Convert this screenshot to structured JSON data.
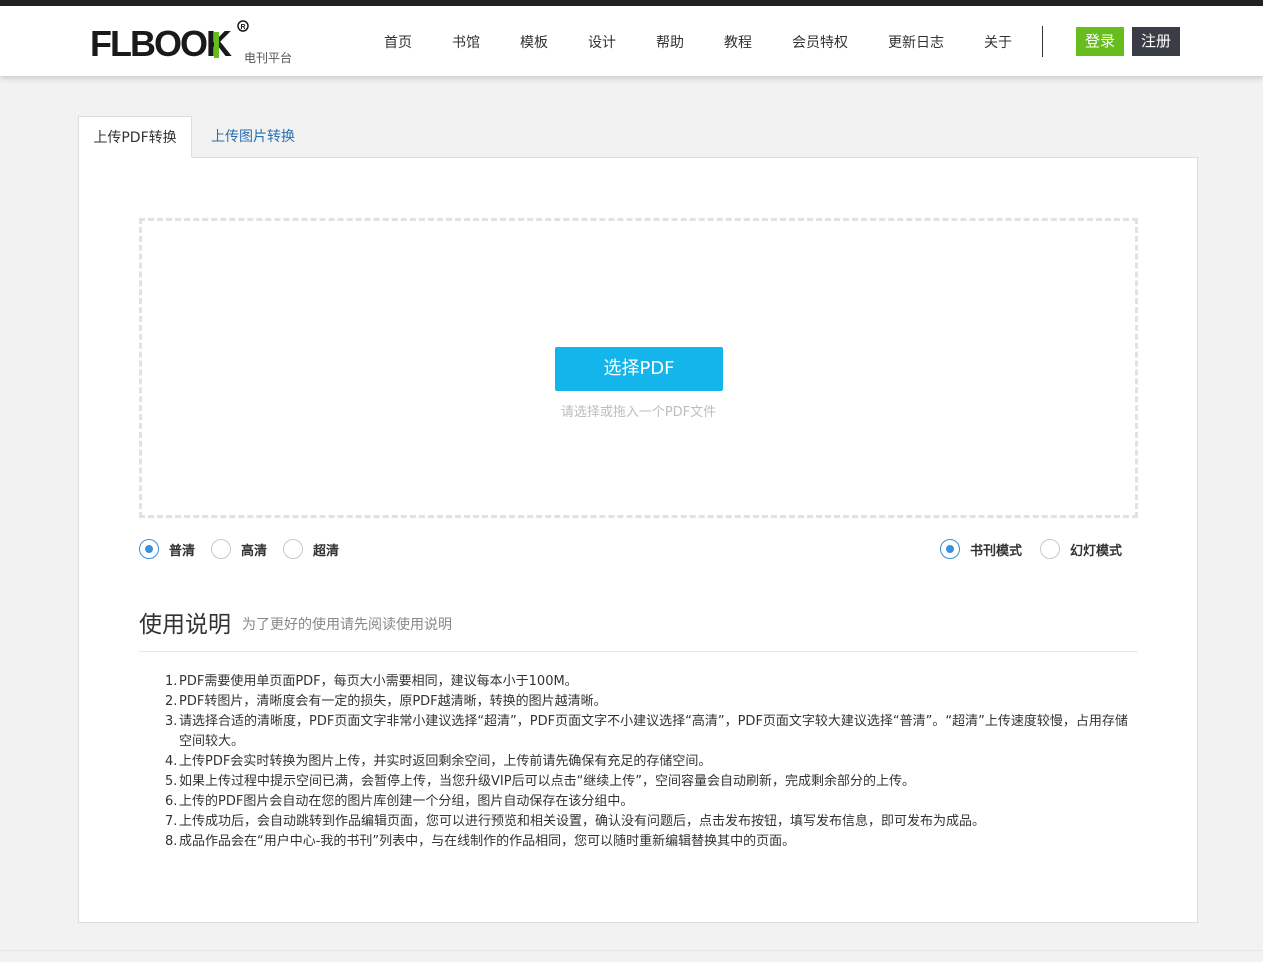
{
  "header": {
    "logo_text": "FLBOOK",
    "logo_subtitle": "电刊平台",
    "nav": [
      {
        "label": "首页"
      },
      {
        "label": "书馆"
      },
      {
        "label": "模板"
      },
      {
        "label": "设计"
      },
      {
        "label": "帮助"
      },
      {
        "label": "教程"
      },
      {
        "label": "会员特权"
      },
      {
        "label": "更新日志"
      },
      {
        "label": "关于"
      }
    ],
    "login_label": "登录",
    "register_label": "注册",
    "colors": {
      "login": "#67bd1d",
      "register": "#3a3d45"
    }
  },
  "tabs": [
    {
      "label": "上传PDF转换",
      "active": true
    },
    {
      "label": "上传图片转换",
      "active": false
    }
  ],
  "upload": {
    "button_label": "选择PDF",
    "hint": "请选择或拖入一个PDF文件",
    "button_color": "#13b5ea"
  },
  "quality_options": [
    {
      "label": "普清",
      "checked": true
    },
    {
      "label": "高清",
      "checked": false
    },
    {
      "label": "超清",
      "checked": false
    }
  ],
  "mode_options": [
    {
      "label": "书刊模式",
      "checked": true
    },
    {
      "label": "幻灯模式",
      "checked": false
    }
  ],
  "instructions": {
    "title": "使用说明",
    "subtitle": "为了更好的使用请先阅读使用说明",
    "items": [
      "PDF需要使用单页面PDF，每页大小需要相同，建议每本小于100M。",
      "PDF转图片，清晰度会有一定的损失，原PDF越清晰，转换的图片越清晰。",
      "请选择合适的清晰度，PDF页面文字非常小建议选择“超清”，PDF页面文字不小建议选择“高清”，PDF页面文字较大建议选择“普清”。“超清”上传速度较慢，占用存储空间较大。",
      "上传PDF会实时转换为图片上传，并实时返回剩余空间，上传前请先确保有充足的存储空间。",
      "如果上传过程中提示空间已满，会暂停上传，当您升级VIP后可以点击“继续上传”，空间容量会自动刷新，完成剩余部分的上传。",
      "上传的PDF图片会自动在您的图片库创建一个分组，图片自动保存在该分组中。",
      "上传成功后，会自动跳转到作品编辑页面，您可以进行预览和相关设置，确认没有问题后，点击发布按钮，填写发布信息，即可发布为成品。",
      "成品作品会在“用户中心-我的书刊”列表中，与在线制作的作品相同，您可以随时重新编辑替换其中的页面。"
    ]
  }
}
